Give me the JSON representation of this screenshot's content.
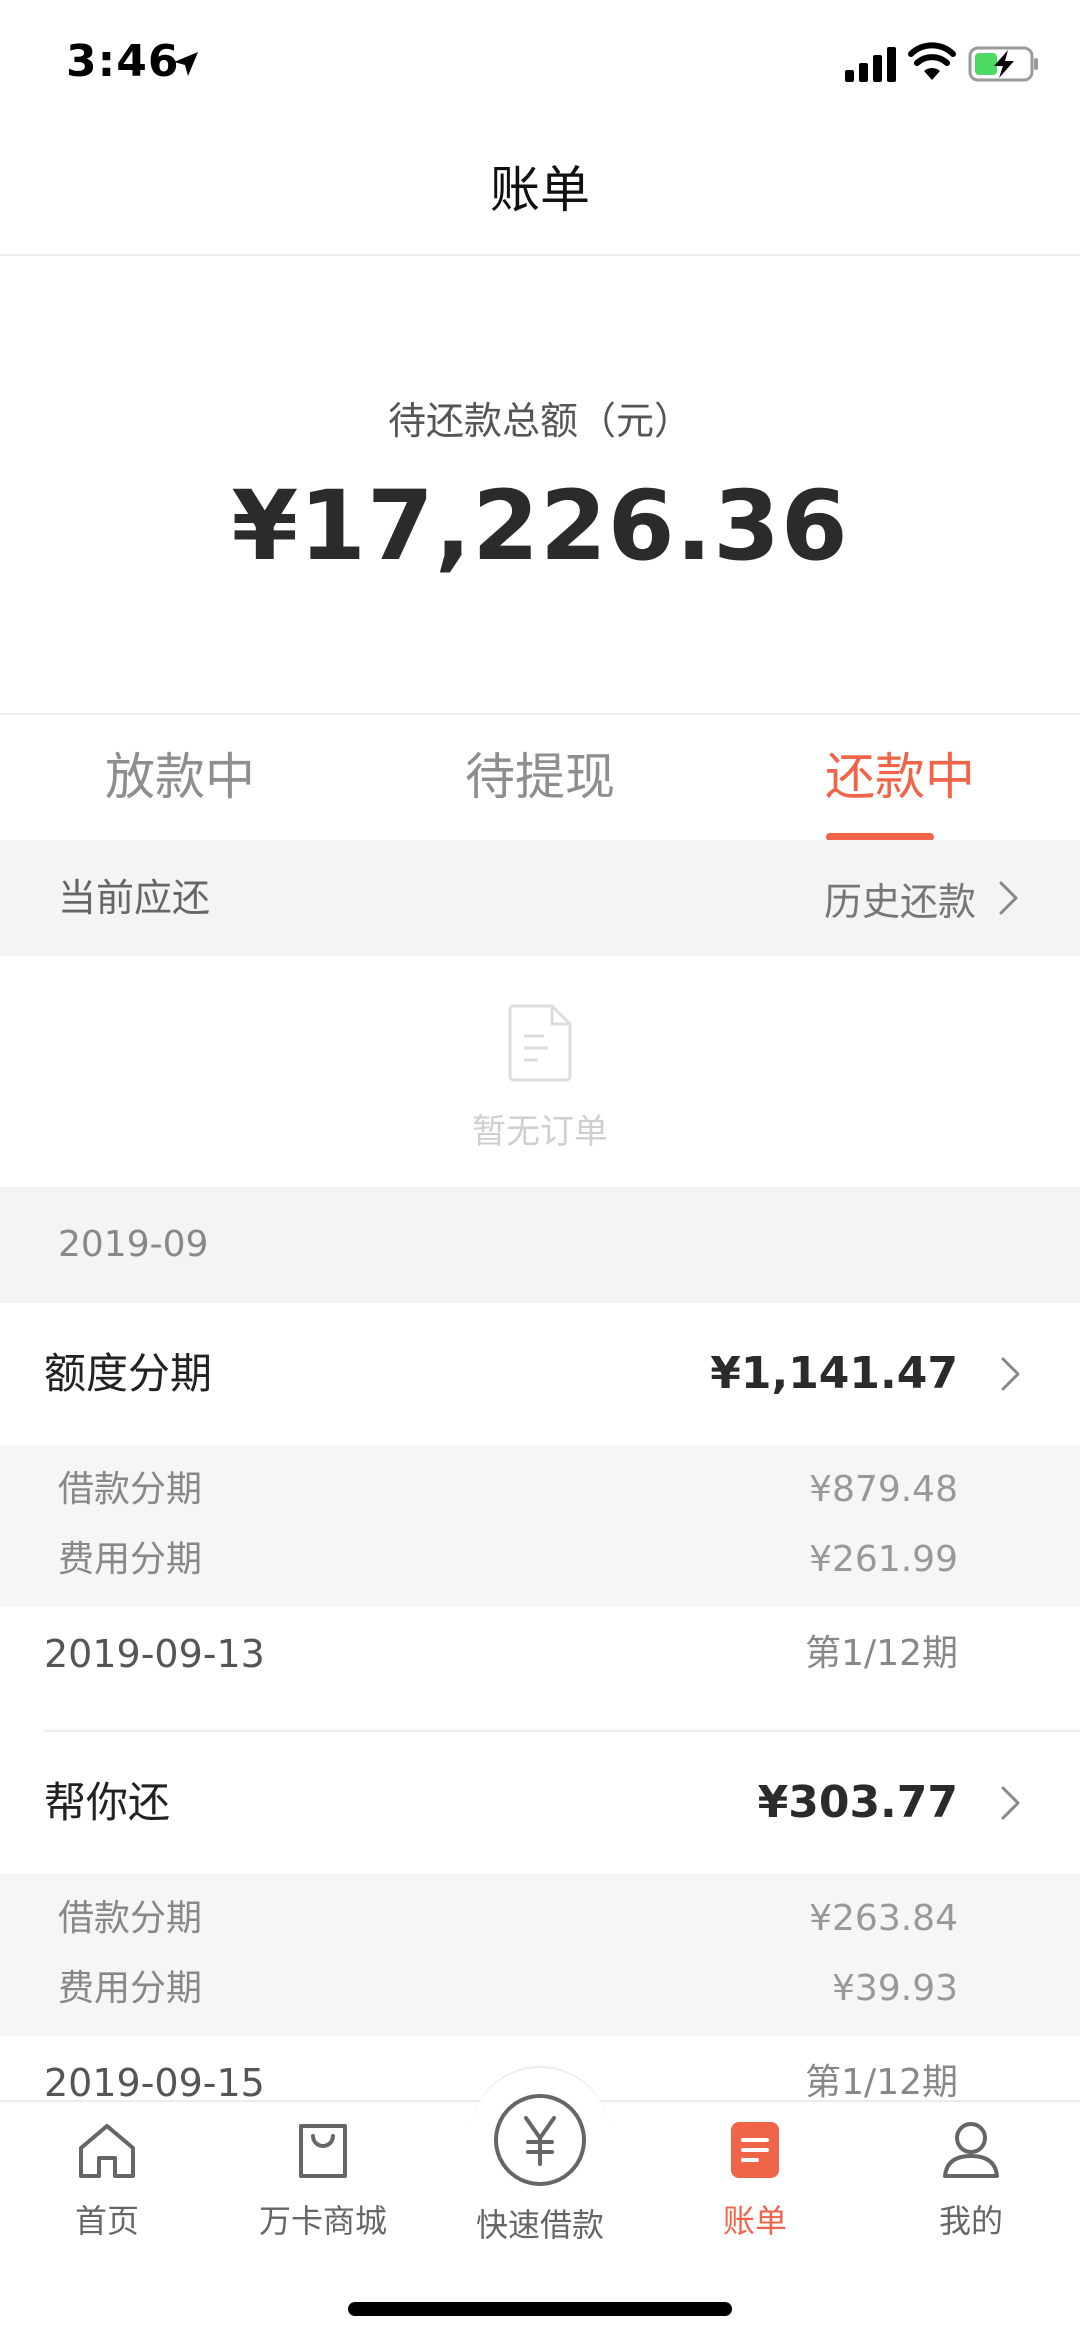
{
  "status_bar": {
    "time": "3:46"
  },
  "nav": {
    "title": "账单"
  },
  "summary": {
    "label": "待还款总额（元）",
    "amount": "¥17,226.36"
  },
  "tabs": [
    {
      "label": "放款中",
      "active": false
    },
    {
      "label": "待提现",
      "active": false
    },
    {
      "label": "还款中",
      "active": true
    }
  ],
  "current": {
    "label": "当前应还",
    "history_link": "历史还款",
    "empty_text": "暂无订单"
  },
  "month": "2019-09",
  "bills": [
    {
      "title": "额度分期",
      "amount": "¥1,141.47",
      "details": [
        {
          "label": "借款分期",
          "value": "¥879.48"
        },
        {
          "label": "费用分期",
          "value": "¥261.99"
        }
      ],
      "date": "2019-09-13",
      "term": "第1/12期"
    },
    {
      "title": "帮你还",
      "amount": "¥303.77",
      "details": [
        {
          "label": "借款分期",
          "value": "¥263.84"
        },
        {
          "label": "费用分期",
          "value": "¥39.93"
        }
      ],
      "date": "2019-09-15",
      "term": "第1/12期"
    }
  ],
  "tabbar": {
    "items": [
      {
        "label": "首页",
        "icon": "home-icon"
      },
      {
        "label": "万卡商城",
        "icon": "shopping-bag-icon"
      },
      {
        "label": "快速借款",
        "icon": "yen-circle-icon"
      },
      {
        "label": "账单",
        "icon": "bill-icon",
        "active": true
      },
      {
        "label": "我的",
        "icon": "profile-icon"
      }
    ]
  },
  "colors": {
    "accent": "#f0644a",
    "section_bg": "#f3f4f6"
  }
}
